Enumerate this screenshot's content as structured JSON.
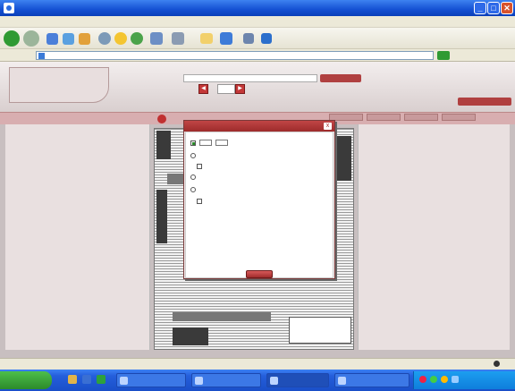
{
  "window": {
    "title": ""
  },
  "menubar": {
    "items": [
      "",
      "",
      "",
      "",
      "",
      ""
    ]
  },
  "address": {
    "url": ""
  },
  "header": {
    "logo_text": "",
    "page_number": "",
    "note": "",
    "right_label": ""
  },
  "subbar": {
    "left_text": ""
  },
  "dialog": {
    "title": "",
    "option_pages": "",
    "option_pages_sep": "",
    "option_current": "",
    "option_current_sub": "",
    "option_clippings": "",
    "option_clippings_current": "",
    "option_clippings_sub": "",
    "download_link": "",
    "button": ""
  },
  "statusbar": {
    "zone": ""
  },
  "taskbar": {
    "start": "",
    "tasks": [
      "",
      "",
      "",
      ""
    ]
  },
  "colors": {
    "accent": "#b04040",
    "title_blue": "#1450d2",
    "dialog_header": "#a83232"
  }
}
